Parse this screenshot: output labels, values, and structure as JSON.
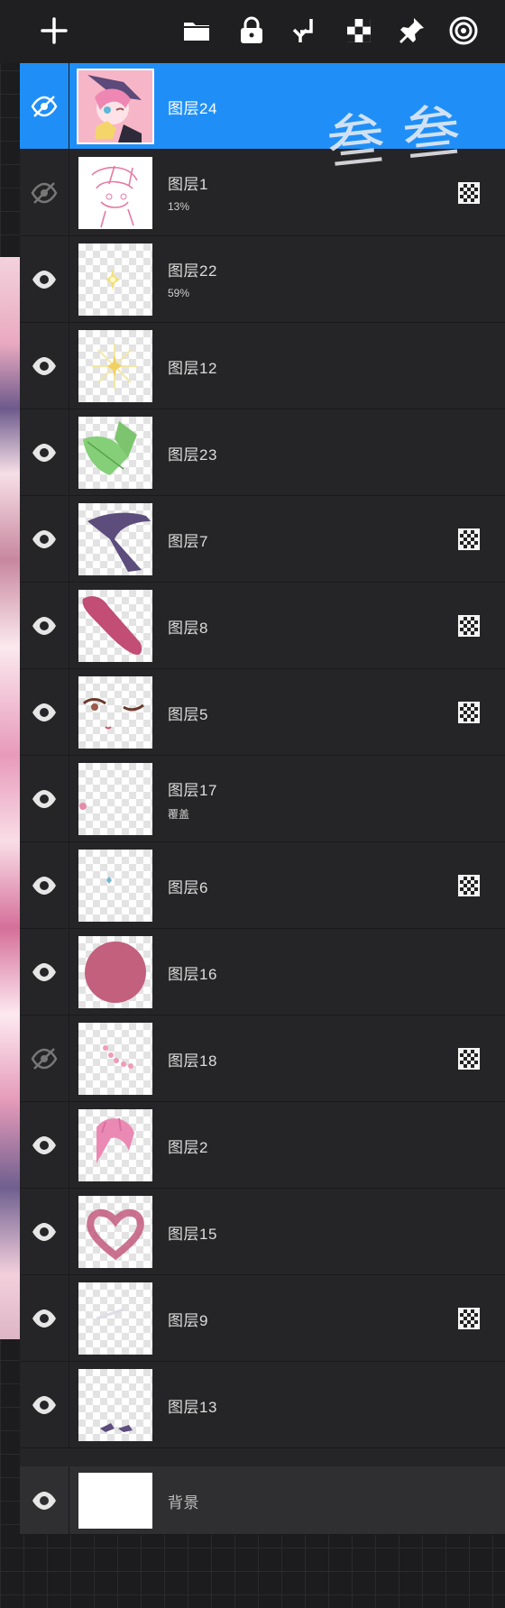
{
  "toolbar": {
    "icons": [
      "add-icon",
      "folder-icon",
      "lock-icon",
      "merge-down-icon",
      "checker-icon",
      "pin-icon",
      "target-icon"
    ]
  },
  "signature": "叁叁",
  "layers": [
    {
      "name": "图层24",
      "sub": "",
      "visible": true,
      "selected": true,
      "blend": false,
      "thumb": "character"
    },
    {
      "name": "图层1",
      "sub": "13%",
      "visible": false,
      "selected": false,
      "blend": true,
      "thumb": "sketch"
    },
    {
      "name": "图层22",
      "sub": "59%",
      "visible": true,
      "selected": false,
      "blend": false,
      "thumb": "sparkle-small"
    },
    {
      "name": "图层12",
      "sub": "",
      "visible": true,
      "selected": false,
      "blend": false,
      "thumb": "sparkle"
    },
    {
      "name": "图层23",
      "sub": "",
      "visible": true,
      "selected": false,
      "blend": false,
      "thumb": "leaf"
    },
    {
      "name": "图层7",
      "sub": "",
      "visible": true,
      "selected": false,
      "blend": true,
      "thumb": "hat"
    },
    {
      "name": "图层8",
      "sub": "",
      "visible": true,
      "selected": false,
      "blend": true,
      "thumb": "hair-strand"
    },
    {
      "name": "图层5",
      "sub": "",
      "visible": true,
      "selected": false,
      "blend": true,
      "thumb": "eyes"
    },
    {
      "name": "图层17",
      "sub": "覆盖",
      "visible": true,
      "selected": false,
      "blend": false,
      "thumb": "dot"
    },
    {
      "name": "图层6",
      "sub": "",
      "visible": true,
      "selected": false,
      "blend": true,
      "thumb": "tiny-blue"
    },
    {
      "name": "图层16",
      "sub": "",
      "visible": true,
      "selected": false,
      "blend": false,
      "thumb": "circle"
    },
    {
      "name": "图层18",
      "sub": "",
      "visible": false,
      "selected": false,
      "blend": true,
      "thumb": "dots-pink"
    },
    {
      "name": "图层2",
      "sub": "",
      "visible": true,
      "selected": false,
      "blend": false,
      "thumb": "hair-pink"
    },
    {
      "name": "图层15",
      "sub": "",
      "visible": true,
      "selected": false,
      "blend": false,
      "thumb": "heart"
    },
    {
      "name": "图层9",
      "sub": "",
      "visible": true,
      "selected": false,
      "blend": true,
      "thumb": "faint"
    },
    {
      "name": "图层13",
      "sub": "",
      "visible": true,
      "selected": false,
      "blend": false,
      "thumb": "bow"
    }
  ],
  "background_layer": {
    "name": "背景",
    "visible": true
  },
  "colors": {
    "selected": "#1f8ff7",
    "panel": "#252527",
    "toolbar": "#1f1f21"
  }
}
